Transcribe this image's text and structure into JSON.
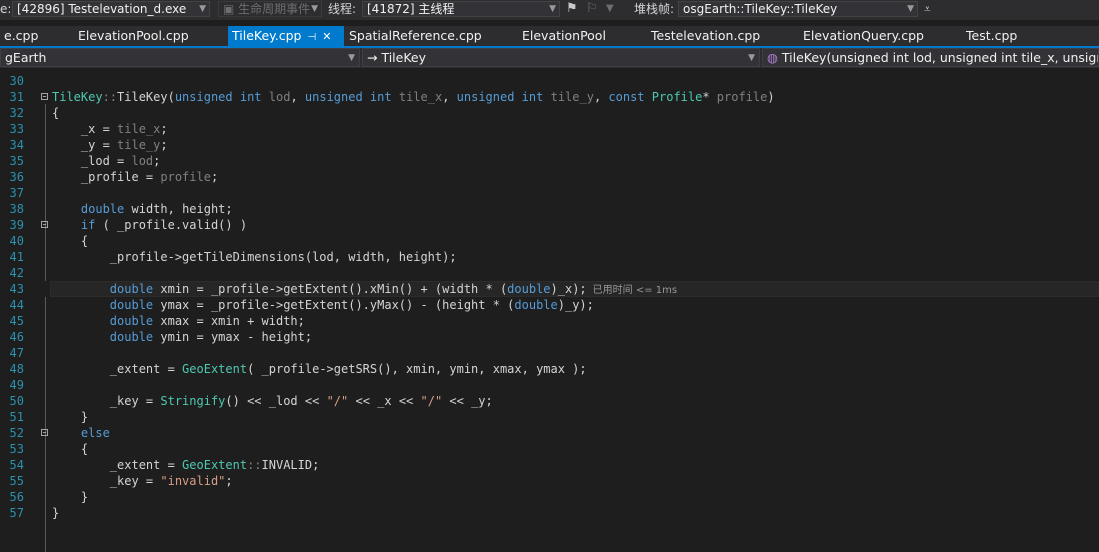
{
  "toolbar": {
    "process_prefix": "e:",
    "process_value": "[42896] Testelevation_d.exe",
    "lifecycle_label": "生命周期事件",
    "thread_label": "线程:",
    "thread_value": "[41872] 主线程",
    "stack_label": "堆栈帧:",
    "stack_value": "osgEarth::TileKey::TileKey"
  },
  "tabs": [
    {
      "label": "e.cpp"
    },
    {
      "label": "ElevationPool.cpp"
    },
    {
      "label": "TileKey.cpp",
      "active": true
    },
    {
      "label": "SpatialReference.cpp"
    },
    {
      "label": "ElevationPool"
    },
    {
      "label": "Testelevation.cpp"
    },
    {
      "label": "ElevationQuery.cpp"
    },
    {
      "label": "Test.cpp"
    }
  ],
  "navbar": {
    "project": "gEarth",
    "scope": "→ TileKey",
    "member": "TileKey(unsigned int lod, unsigned int tile_x, unsigned"
  },
  "code": {
    "line_numbers": [
      "30",
      "31",
      "32",
      "33",
      "34",
      "35",
      "36",
      "37",
      "38",
      "39",
      "40",
      "41",
      "42",
      "43",
      "44",
      "45",
      "46",
      "47",
      "48",
      "49",
      "50",
      "51",
      "52",
      "53",
      "54",
      "55",
      "56",
      "57"
    ],
    "perf_hint": "已用时间 <= 1ms"
  },
  "colors": {
    "accent": "#007acc",
    "keyword": "#569cd6",
    "type": "#4ec9b0",
    "parameter": "#808080",
    "string": "#d69d85"
  }
}
